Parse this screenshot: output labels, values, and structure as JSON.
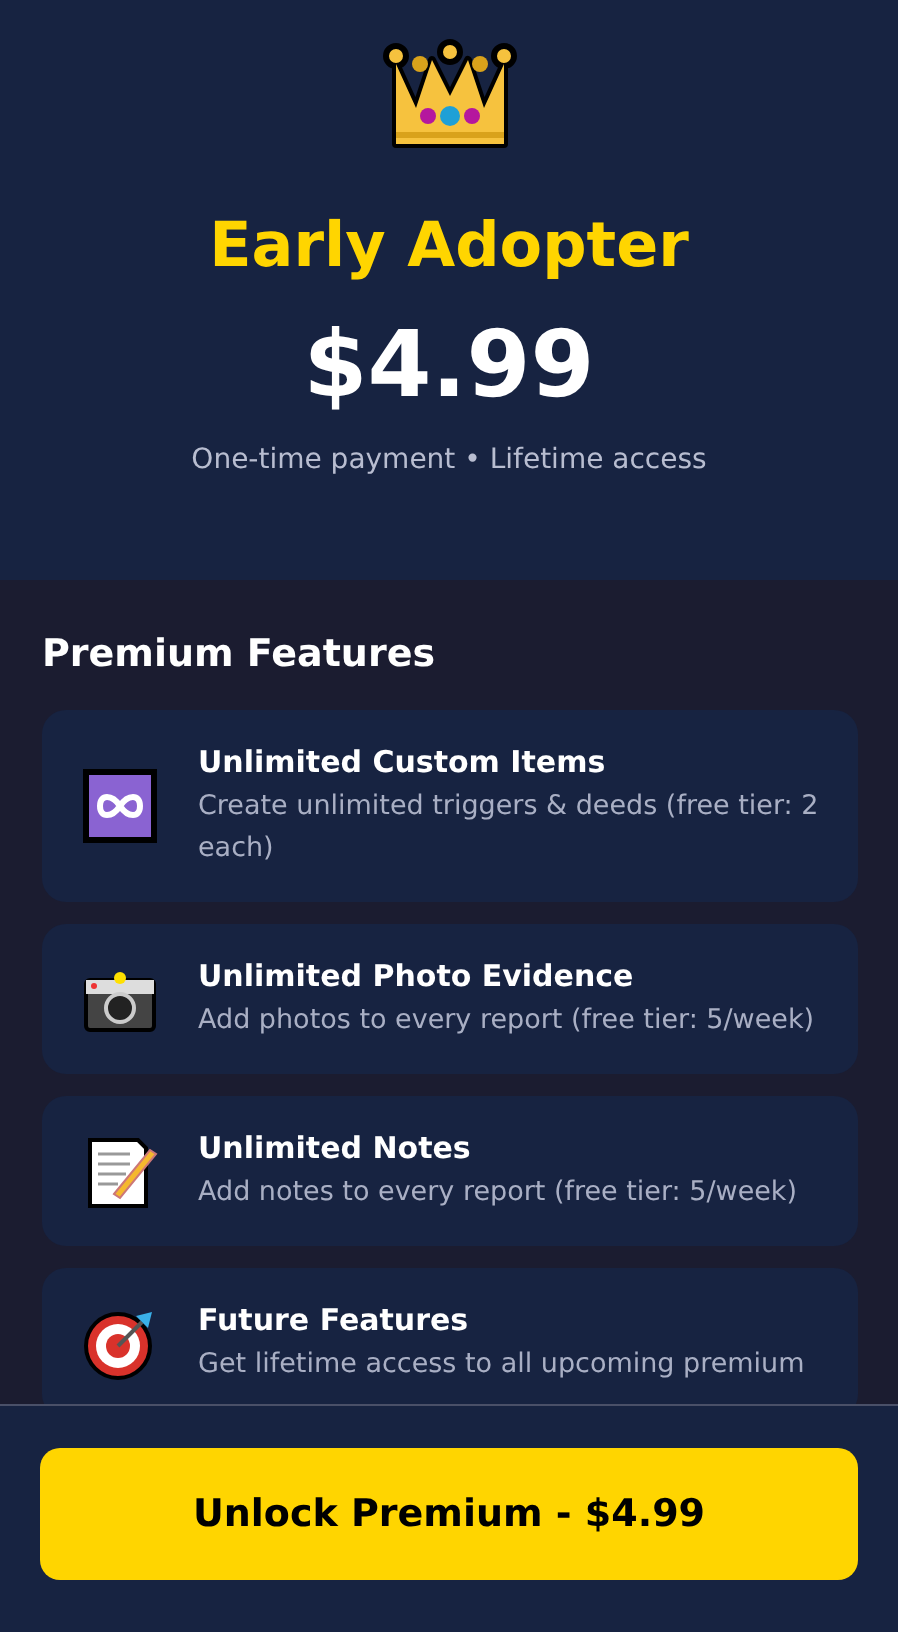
{
  "header": {
    "title": "Early Adopter",
    "price": "$4.99",
    "subtitle": "One-time payment • Lifetime access"
  },
  "section_title": "Premium Features",
  "features": [
    {
      "kind": "infinity",
      "title": "Unlimited Custom Items",
      "description": "Create unlimited triggers & deeds (free tier: 2 each)"
    },
    {
      "kind": "camera",
      "title": "Unlimited Photo Evidence",
      "description": "Add photos to every report (free tier: 5/week)"
    },
    {
      "kind": "notes",
      "title": "Unlimited Notes",
      "description": "Add notes to every report (free tier: 5/week)"
    },
    {
      "kind": "target",
      "title": "Future Features",
      "description": "Get lifetime access to all upcoming premium"
    }
  ],
  "button": "Unlock Premium - $4.99"
}
